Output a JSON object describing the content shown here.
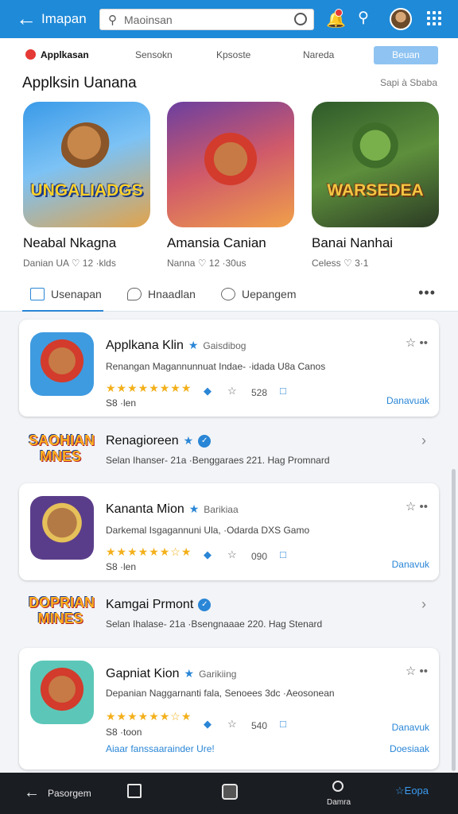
{
  "header": {
    "title": "Imapan",
    "search_placeholder": "Maoinsan"
  },
  "categories": [
    {
      "label": "Applkasan"
    },
    {
      "label": "Sensokn"
    },
    {
      "label": "Kpsoste"
    },
    {
      "label": "Nareda"
    },
    {
      "label": "Beuan"
    }
  ],
  "featured": {
    "title": "Applksin Uanana",
    "see_all": "Sapi à Sbaba",
    "items": [
      {
        "name": "Neabal Nkagna",
        "meta": "Danian UA ♡ 12 ·klds",
        "icon_text": "UNGALIADGS"
      },
      {
        "name": "Amansia Canian",
        "meta": "Nanna ♡ 12 ·30us",
        "icon_text": ""
      },
      {
        "name": "Banai Nanhai",
        "meta": "Celess ♡ 3·1",
        "icon_text": "WARSEDEA"
      }
    ]
  },
  "subtabs": [
    {
      "label": "Usenapan"
    },
    {
      "label": "Hnaadlan"
    },
    {
      "label": "Uepangem"
    }
  ],
  "apps": [
    {
      "title": "Applkana Klin",
      "tag": "Gaisdibog",
      "desc": "Renangan Magannunnuat Indae- ·idada U8a Canos",
      "size": "528",
      "sub": "S8 ·len",
      "download": "Danavuak"
    },
    {
      "title": "Renagioreen",
      "desc": "Selan Ihanser- 21a ·Benggaraes 221. Hag Promnard",
      "logo": "SAOHIAN MNES"
    },
    {
      "title": "Kananta Mion",
      "tag": "Barikiaa",
      "desc": "Darkemal Isgagannuni Ula, ·Odarda DXS Gamo",
      "size": "090",
      "sub": "S8 ·len",
      "download": "Danavuk"
    },
    {
      "title": "Kamgai Prmont",
      "desc": "Selan Ihalase- 21a ·Bsengnaaae 220. Hag Stenard",
      "logo": "DOPRIAN MINES"
    },
    {
      "title": "Gapniat Kion",
      "tag": "Garikiing",
      "desc": "Depanian Naggarnanti fala, Senoees 3dc ·Aeosonean",
      "size": "540",
      "sub": "S8 ·toon",
      "download": "Danavuk",
      "promo": "Aiaar fanssaarainder Ure!",
      "promo_action": "Doesiaak"
    }
  ],
  "bottom_nav": [
    {
      "label": "Pasorgem"
    },
    {
      "label": "Damra"
    },
    {
      "label": "Eopa"
    }
  ],
  "colors": {
    "primary": "#1f8ad8",
    "accent": "#2a86d6",
    "rating": "#f3b01b",
    "nav": "#1a1d22"
  }
}
